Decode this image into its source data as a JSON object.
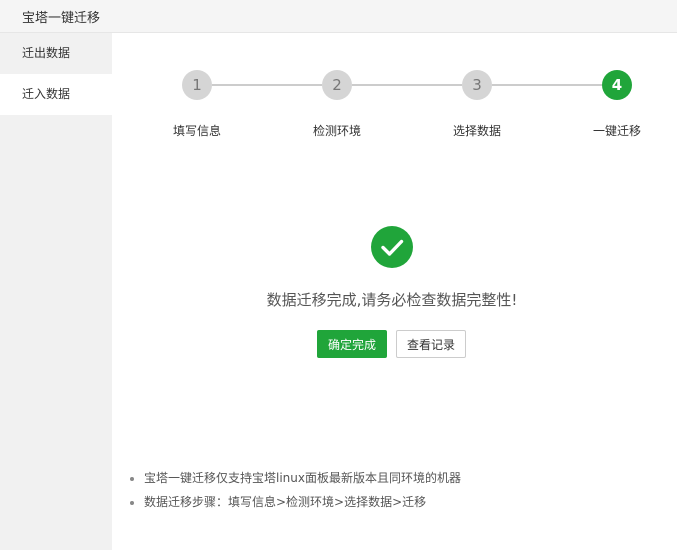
{
  "window": {
    "title": "宝塔一键迁移"
  },
  "sidebar": {
    "items": [
      {
        "label": "迁出数据",
        "active": false
      },
      {
        "label": "迁入数据",
        "active": true
      }
    ]
  },
  "steps": [
    {
      "number": "1",
      "label": "填写信息",
      "state": "pending"
    },
    {
      "number": "2",
      "label": "检测环境",
      "state": "pending"
    },
    {
      "number": "3",
      "label": "选择数据",
      "state": "pending"
    },
    {
      "number": "4",
      "label": "一键迁移",
      "state": "current"
    }
  ],
  "result": {
    "icon": "check-icon",
    "message": "数据迁移完成,请务必检查数据完整性!",
    "confirm_label": "确定完成",
    "log_label": "查看记录"
  },
  "notes": [
    "宝塔一键迁移仅支持宝塔linux面板最新版本且同环境的机器",
    "数据迁移步骤：填写信息>检测环境>选择数据>迁移"
  ],
  "colors": {
    "accent": "#20a53a",
    "step_inactive": "#d5d5d5",
    "sidebar_bg": "#f1f1f1"
  }
}
